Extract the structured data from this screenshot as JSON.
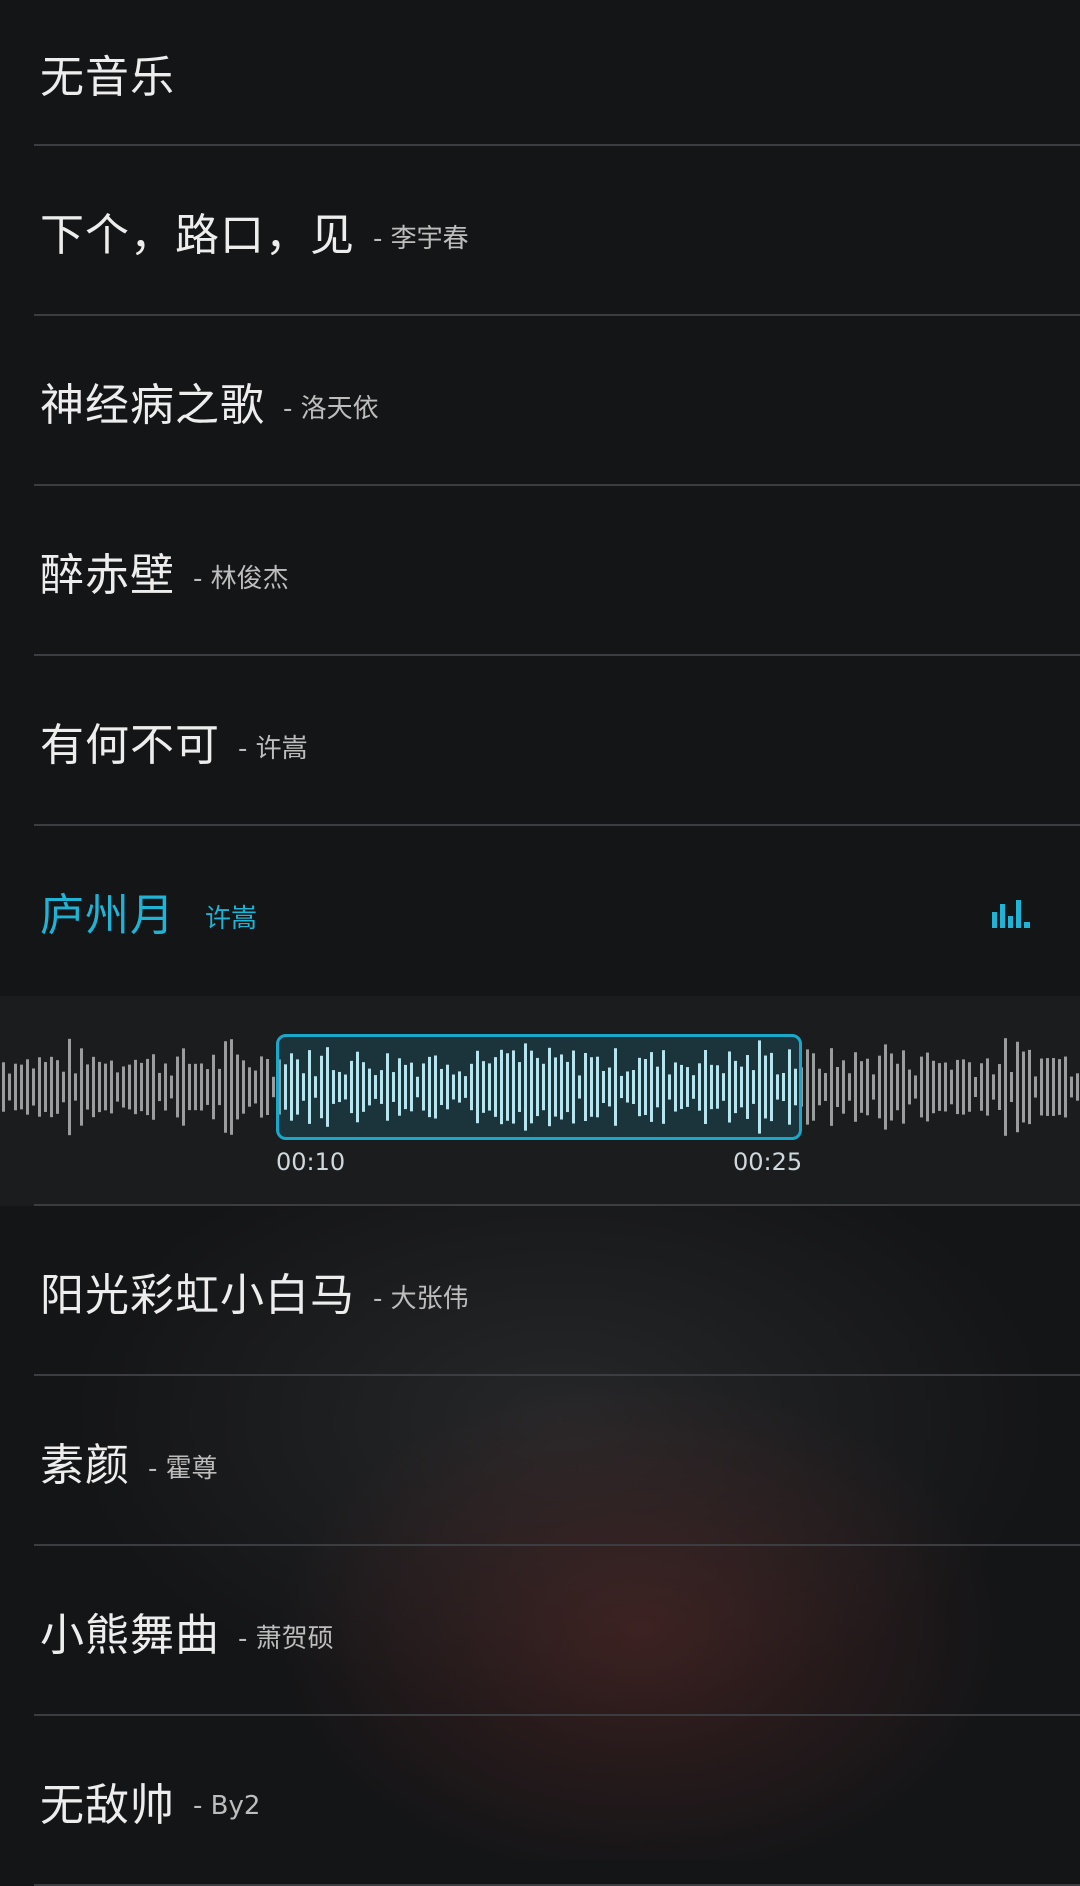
{
  "songs_before": [
    {
      "title": "无音乐",
      "artist": ""
    },
    {
      "title": "下个，路口，见",
      "artist": "- 李宇春"
    },
    {
      "title": "神经病之歌",
      "artist": "- 洛天依"
    },
    {
      "title": "醉赤壁",
      "artist": "- 林俊杰"
    },
    {
      "title": "有何不可",
      "artist": "- 许嵩"
    }
  ],
  "current": {
    "title": "庐州月",
    "artist": "许嵩",
    "icon": "equalizer-icon",
    "accent_color": "#1fb3d6",
    "selection_start": "00:10",
    "selection_end": "00:25"
  },
  "songs_after": [
    {
      "title": "阳光彩虹小白马",
      "artist": "- 大张伟"
    },
    {
      "title": "素颜",
      "artist": "- 霍尊"
    },
    {
      "title": "小熊舞曲",
      "artist": "- 萧贺硕"
    },
    {
      "title": "无敌帅",
      "artist": "- By2"
    }
  ]
}
